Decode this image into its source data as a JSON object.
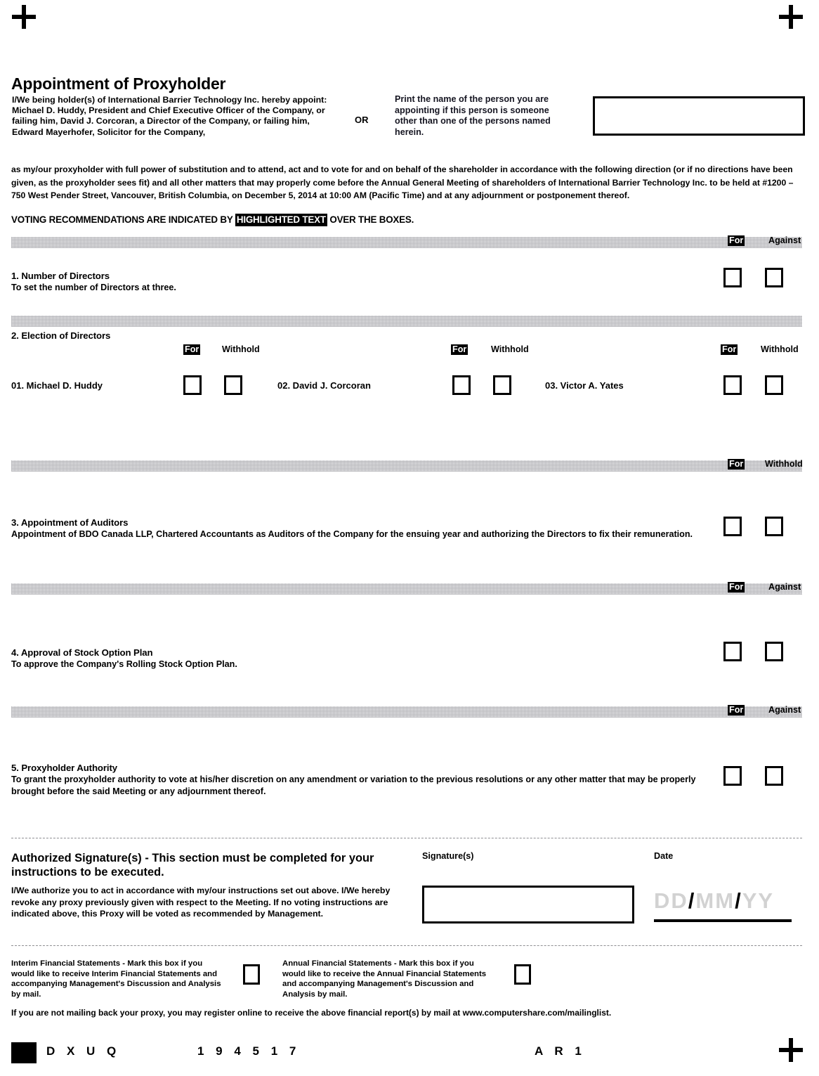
{
  "document": {
    "title": "Appointment of Proxyholder",
    "appoint_text": "I/We being holder(s) of International Barrier Technology Inc. hereby appoint: Michael D. Huddy, President and Chief Executive Officer of the Company, or failing him, David J. Corcoran, a Director of the Company, or failing him, Edward Mayerhofer, Solicitor for the Company,",
    "or_label": "OR",
    "print_name_text": "Print the name of the person you are appointing if this person is someone other than one of the persons named herein.",
    "appointee_value": "",
    "proxy_paragraph": "as my/our proxyholder with full power of substitution and to attend, act and to vote for and on behalf of the shareholder in accordance with the following direction (or if no directions have been given, as the proxyholder sees fit) and all other matters that may properly come before the Annual General Meeting of shareholders of International Barrier Technology Inc. to be held at #1200 – 750 West Pender Street, Vancouver, British Columbia, on December 5, 2014 at 10:00 AM (Pacific Time) and at any adjournment or postponement thereof.",
    "voting_rec_prefix": "VOTING RECOMMENDATIONS ARE INDICATED BY ",
    "voting_rec_highlight": "HIGHLIGHTED TEXT",
    "voting_rec_suffix": " OVER THE BOXES."
  },
  "resolutions": [
    {
      "number": "1.",
      "title": "1. Number of Directors",
      "description": "To set the number of Directors at three.",
      "option_for": "For",
      "option_against": "Against",
      "recommended": "For"
    },
    {
      "number": "2.",
      "title": "2. Election of Directors",
      "option_for": "For",
      "option_withhold": "Withhold",
      "recommended": "For",
      "directors": [
        {
          "label": "01. Michael D. Huddy"
        },
        {
          "label": "02. David J. Corcoran"
        },
        {
          "label": "03. Victor A. Yates"
        }
      ]
    },
    {
      "number": "3.",
      "title": "3. Appointment of Auditors",
      "description": "Appointment of BDO Canada LLP, Chartered Accountants as Auditors of the Company for the ensuing year and authorizing the Directors to fix their remuneration.",
      "option_for": "For",
      "option_withhold": "Withhold",
      "recommended": "For"
    },
    {
      "number": "4.",
      "title": "4. Approval of Stock Option Plan",
      "description": "To approve the Company's Rolling Stock Option Plan.",
      "option_for": "For",
      "option_against": "Against",
      "recommended": "For"
    },
    {
      "number": "5.",
      "title": "5. Proxyholder Authority",
      "description": "To grant the proxyholder authority to vote at his/her discretion on any amendment or variation to the previous resolutions or any other matter that may be properly brought before the said Meeting or any adjournment thereof.",
      "option_for": "For",
      "option_against": "Against",
      "recommended": "For"
    }
  ],
  "signature_section": {
    "title": "Authorized Signature(s) - This section must be completed for your instructions to be executed.",
    "body_part1": "I/We authorize you to act in accordance with my/our instructions set out above. I/We hereby revoke any proxy previously given with respect to the Meeting. ",
    "body_part2": "If no voting instructions are indicated above, this Proxy will be voted as recommended by Management.",
    "signature_label": "Signature(s)",
    "signature_value": "",
    "date_label": "Date",
    "date_placeholder_dd": "DD",
    "date_placeholder_mm": "MM",
    "date_placeholder_yy": "YY",
    "date_separator": "/",
    "date_value": ""
  },
  "financial_statements": {
    "interim": "Interim Financial Statements - Mark this box if you would like to receive Interim Financial Statements and accompanying Management's Discussion and Analysis by mail.",
    "annual": "Annual Financial Statements - Mark this box if you would like to receive the Annual Financial Statements and accompanying Management's Discussion and Analysis by mail.",
    "mailing_note": "If you are not mailing back your proxy, you may register online to receive the above financial report(s) by mail at www.computershare.com/mailinglist."
  },
  "footer": {
    "code_letters": "D X U Q",
    "code_number": "1 9 4 5 1 7",
    "code_right": "A R 1"
  }
}
